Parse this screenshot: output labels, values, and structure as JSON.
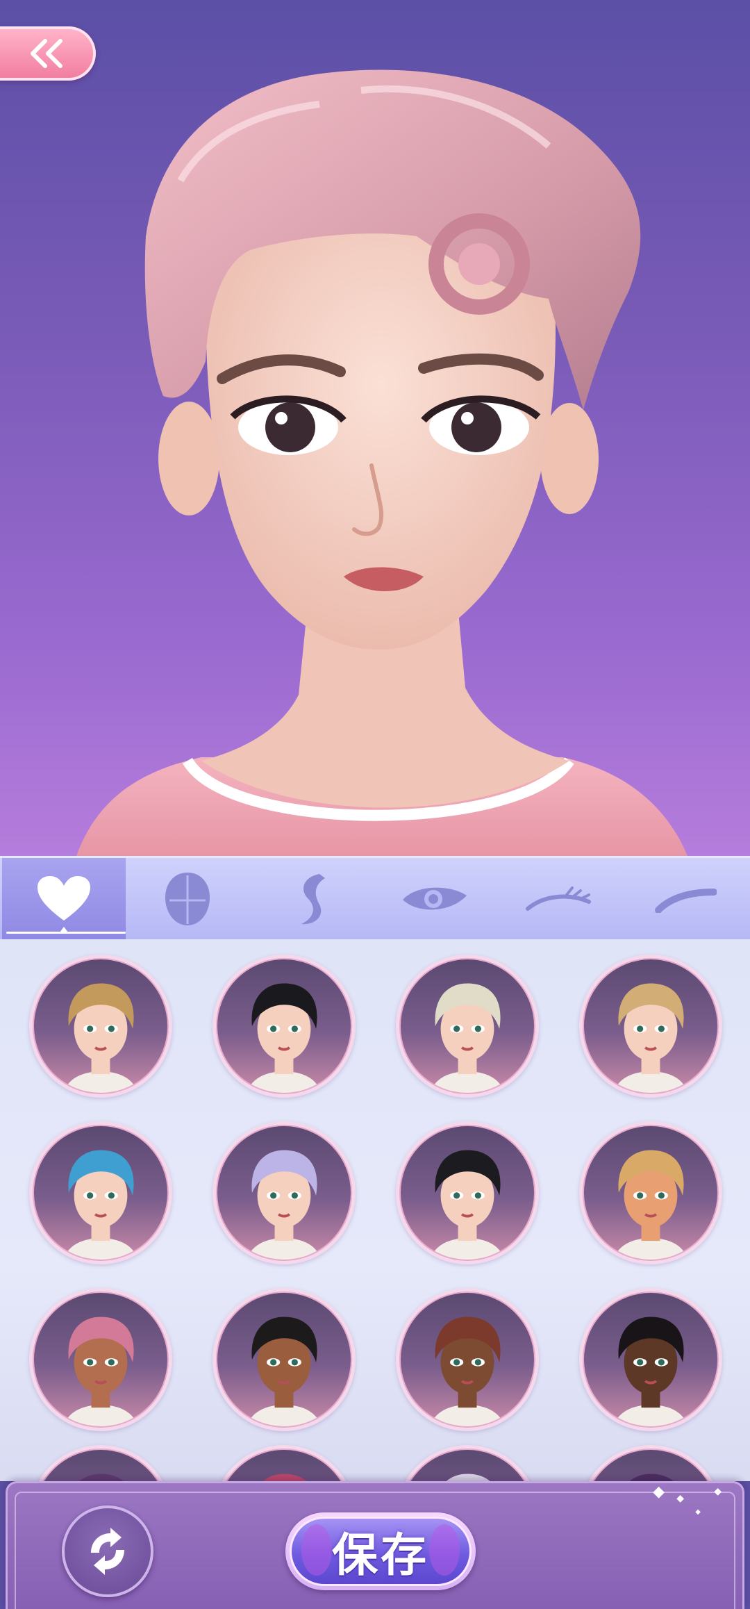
{
  "app": {
    "screen": "hairstyle-editor"
  },
  "header": {
    "back_icon": "double-chevron-left-icon"
  },
  "preview": {
    "character": "avatar-pink-pompadour",
    "hair_color": "#e9aab8",
    "top_color": "#f2a4b2"
  },
  "tabs": [
    {
      "name": "favorites",
      "icon": "heart-icon",
      "active": true
    },
    {
      "name": "face-shape",
      "icon": "head-silhouette-icon",
      "active": false
    },
    {
      "name": "hair",
      "icon": "hair-strand-icon",
      "active": false
    },
    {
      "name": "eyes",
      "icon": "eye-icon",
      "active": false
    },
    {
      "name": "eyelashes",
      "icon": "eyelash-icon",
      "active": false
    },
    {
      "name": "eyebrows",
      "icon": "eyebrow-icon",
      "active": false
    }
  ],
  "hairstyles": [
    {
      "name": "short-side-swept",
      "hair": "#c49a5c",
      "skin": "#f6d0bf"
    },
    {
      "name": "black-bob-bangs",
      "hair": "#1a1a1e",
      "skin": "#f6d0bf"
    },
    {
      "name": "platinum-pixie",
      "hair": "#e0dcc8",
      "skin": "#f6d0bf"
    },
    {
      "name": "wavy-blonde-bob",
      "hair": "#d2ad76",
      "skin": "#f6d0bf"
    },
    {
      "name": "blue-pompadour",
      "hair": "#3f9fd1",
      "skin": "#f6d0bf"
    },
    {
      "name": "lavender-short-bangs",
      "hair": "#bcb3e6",
      "skin": "#f6d0bf"
    },
    {
      "name": "black-short-bangs",
      "hair": "#1c1b20",
      "skin": "#f6d0bf"
    },
    {
      "name": "honey-side-part",
      "hair": "#d9a968",
      "skin": "#e8a073"
    },
    {
      "name": "pink-pompadour",
      "hair": "#d37a98",
      "skin": "#b36e4f"
    },
    {
      "name": "long-braids",
      "hair": "#1d1a1c",
      "skin": "#9a5e3f"
    },
    {
      "name": "box-braids",
      "hair": "#7b3a2c",
      "skin": "#7d4a32"
    },
    {
      "name": "short-curls",
      "hair": "#181417",
      "skin": "#5e3827"
    }
  ],
  "partial_hairstyles": [
    {
      "name": "partial-1",
      "hair": "#5b3a6b"
    },
    {
      "name": "partial-2",
      "hair": "#b9486a"
    },
    {
      "name": "partial-3",
      "hair": "#d9d6e6"
    },
    {
      "name": "partial-4",
      "hair": "#4b2e5e"
    }
  ],
  "footer": {
    "randomize_icon": "shuffle-arrows-icon",
    "save_label": "保存"
  }
}
